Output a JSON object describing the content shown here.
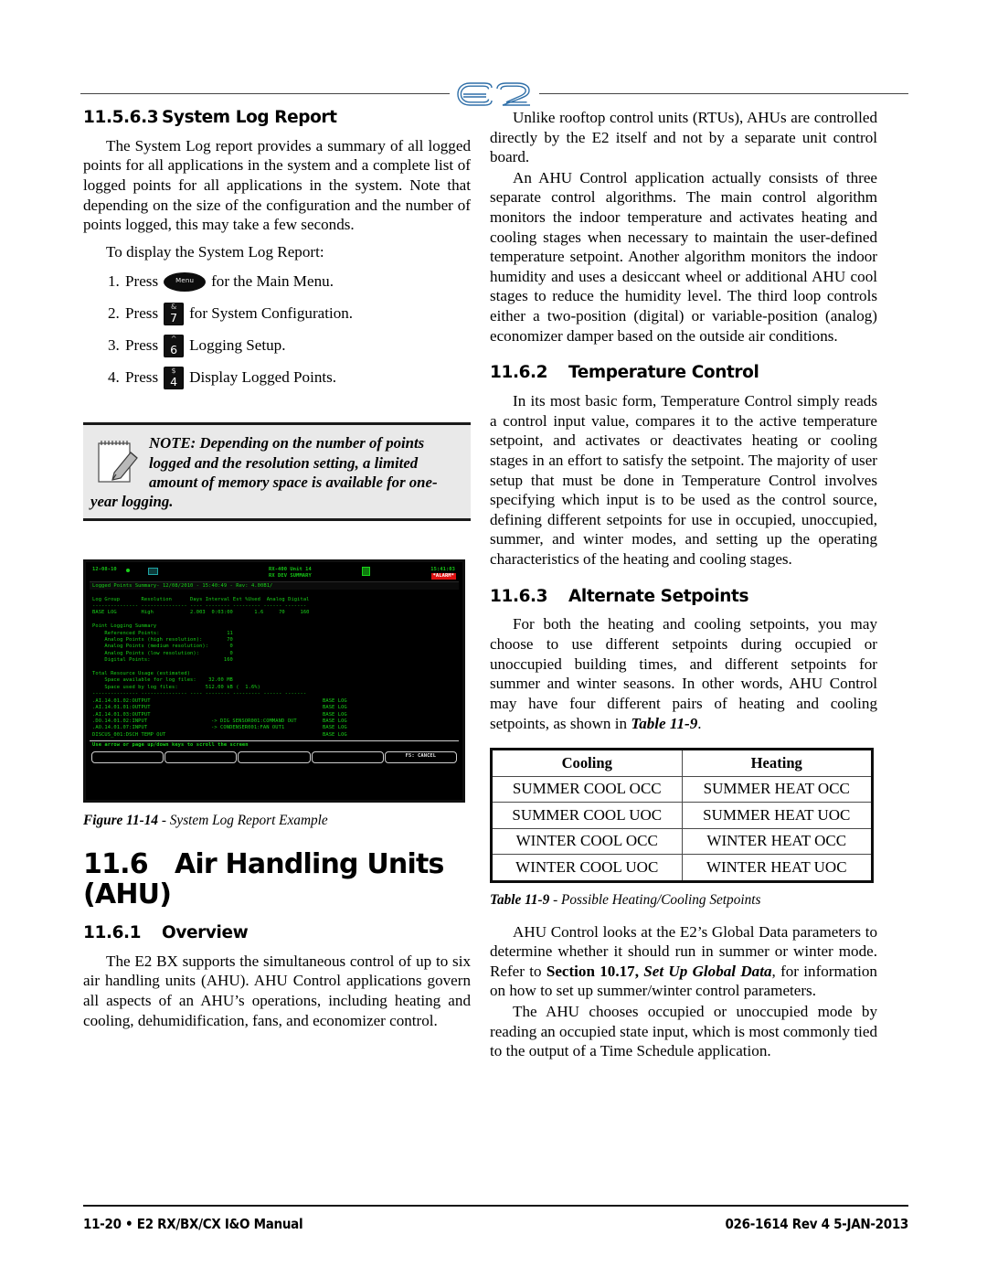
{
  "header": {
    "logo_text": "E2"
  },
  "left_column": {
    "section_heading": {
      "number": "11.5.6.3",
      "title": "System Log Report"
    },
    "intro_paragraph": "The System Log report provides a summary of all logged points for all applications in the system and a complete list of logged points for all applications in the system. Note that depending on the size of the configuration and the number of points logged, this may take a few seconds.",
    "lead_in": "To display the System Log Report:",
    "steps": [
      {
        "num": "1.",
        "verb": "Press",
        "key_type": "oval",
        "key_label": "Menu",
        "tail": "for the Main Menu."
      },
      {
        "num": "2.",
        "verb": "Press",
        "key_type": "square",
        "key_top": "&",
        "key_main": "7",
        "tail": "for System Configuration."
      },
      {
        "num": "3.",
        "verb": "Press",
        "key_type": "square",
        "key_top": "^",
        "key_main": "6",
        "tail": "Logging Setup."
      },
      {
        "num": "4.",
        "verb": "Press",
        "key_type": "square",
        "key_top": "$",
        "key_main": "4",
        "tail": "Display Logged Points."
      }
    ],
    "note": {
      "icon": "notepad-pencil-icon",
      "text": "NOTE: Depending on the number of points logged and the resolution setting, a limited amount of memory space is available for one-year logging."
    },
    "figure": {
      "caption_label": "Figure 11-14",
      "caption_text": " - System Log Report Example",
      "terminal": {
        "date": "12-08-10",
        "unit_line1": "RX-400 Unit 14",
        "unit_line2": "RX DEV SUMMARY",
        "time": "15:41:03",
        "alarm": "*ALARM*",
        "banner": "Logged Points Summary- 12/08/2010 - 15:40:49 - Rev: 4.00B1/",
        "table_header": "Log Group       Resolution      Days Interval Est %Used  Analog Digital",
        "table_divider": "--------------- --------------- ---- -------- --------- ------ -------",
        "table_row": "BASE LOG        High            2.003  0:03:00       1.6     70     160",
        "summary_title": "Point Logging Summary",
        "summary_rows": [
          "    Referenced Points:                      11",
          "    Analog Points (high resolution):        70",
          "    Analog Points (medium resolution):       0",
          "    Analog Points (low resolution):          0",
          "    Digital Points:                        160"
        ],
        "usage_title": "Total Resource Usage (estimated)",
        "usage_rows": [
          "    Space available for log files:    32.00 MB",
          "    Space used by log files:         512.00 kB (  1.6%)"
        ],
        "points": [
          {
            "name": ".AI.14.01.02:OUTPUT",
            "link": "",
            "group": "BASE LOG"
          },
          {
            "name": ".AI.14.01.01:OUTPUT",
            "link": "",
            "group": "BASE LOG"
          },
          {
            "name": ".AI.14.01.03:OUTPUT",
            "link": "",
            "group": "BASE LOG"
          },
          {
            "name": ".DO.14.01.02:INPUT",
            "link": "-> DIG SENSOR001:COMMAND OUT",
            "group": "BASE LOG"
          },
          {
            "name": ".AO.14.01.07:INPUT",
            "link": "-> CONDENSER001:FAN OUT1",
            "group": "BASE LOG"
          },
          {
            "name": "DISCUS_001:DSCH TEMP OUT",
            "link": "",
            "group": "BASE LOG"
          }
        ],
        "scroll_hint": "Use arrow or page up/down keys to scroll the screen",
        "fkeys": [
          "",
          "",
          "",
          "",
          "F5: CANCEL"
        ]
      }
    },
    "chapter_heading": {
      "number": "11.6",
      "title": "Air Handling Units (AHU)"
    },
    "overview_heading": {
      "number": "11.6.1",
      "title": "Overview"
    },
    "overview_paragraph": "The E2 BX supports the simultaneous control of up to six air handling units (AHU). AHU Control applications govern all aspects of an AHU’s operations, including heating and cooling, dehumidification, fans, and economizer control."
  },
  "right_column": {
    "paragraph_1": "Unlike rooftop control units (RTUs), AHUs are controlled directly by the E2 itself and not by a separate unit control board.",
    "paragraph_2": "An AHU Control application actually consists of three separate control algorithms. The main control algorithm monitors the indoor temperature and activates heating and cooling stages when necessary to maintain the user-defined temperature setpoint. Another algorithm monitors the indoor humidity and uses a desiccant wheel or additional AHU cool stages to reduce the humidity level. The third loop controls either a two-position (digital) or variable-position (analog) economizer damper based on the outside air conditions.",
    "temp_heading": {
      "number": "11.6.2",
      "title": "Temperature Control"
    },
    "temp_paragraph": "In its most basic form, Temperature Control simply reads a control input value, compares it to the active temperature setpoint, and activates or deactivates heating or cooling stages in an effort to satisfy the setpoint. The majority of user setup that must be done in Temperature Control involves specifying which input is to be used as the control source, defining different setpoints for use in occupied, unoccupied, summer, and winter modes, and setting up the operating characteristics of the heating and cooling stages.",
    "alt_heading": {
      "number": "11.6.3",
      "title": "Alternate Setpoints"
    },
    "alt_paragraph_pre": "For both the heating and cooling setpoints, you may choose to use different setpoints during occupied or unoccupied building times, and different setpoints for summer and winter seasons. In other words, AHU Control may have four different pairs of heating and cooling setpoints, as shown in ",
    "alt_paragraph_ref": "Table 11-9",
    "alt_paragraph_post": ".",
    "table": {
      "headers": [
        "Cooling",
        "Heating"
      ],
      "rows": [
        [
          "SUMMER COOL OCC",
          "SUMMER HEAT OCC"
        ],
        [
          "SUMMER COOL UOC",
          "SUMMER HEAT UOC"
        ],
        [
          "WINTER COOL OCC",
          "WINTER HEAT OCC"
        ],
        [
          "WINTER COOL UOC",
          "WINTER HEAT UOC"
        ]
      ],
      "caption_label": "Table 11-9",
      "caption_text": " - Possible Heating/Cooling Setpoints"
    },
    "global_paragraph_pre": "AHU Control looks at the E2’s Global Data parameters to determine whether it should run in summer or winter mode. Refer to ",
    "global_paragraph_ref_bold": "Section 10.17, ",
    "global_paragraph_ref_italic": "Set Up Global Data",
    "global_paragraph_post": ", for information on how to set up summer/winter control parameters.",
    "occupied_paragraph": "The AHU chooses occupied or unoccupied mode by reading an occupied state input, which is most commonly tied to the output of a Time Schedule application."
  },
  "footer": {
    "left": "11-20 • E2 RX/BX/CX I&O Manual",
    "right": "026-1614 Rev 4 5-JAN-2013"
  }
}
